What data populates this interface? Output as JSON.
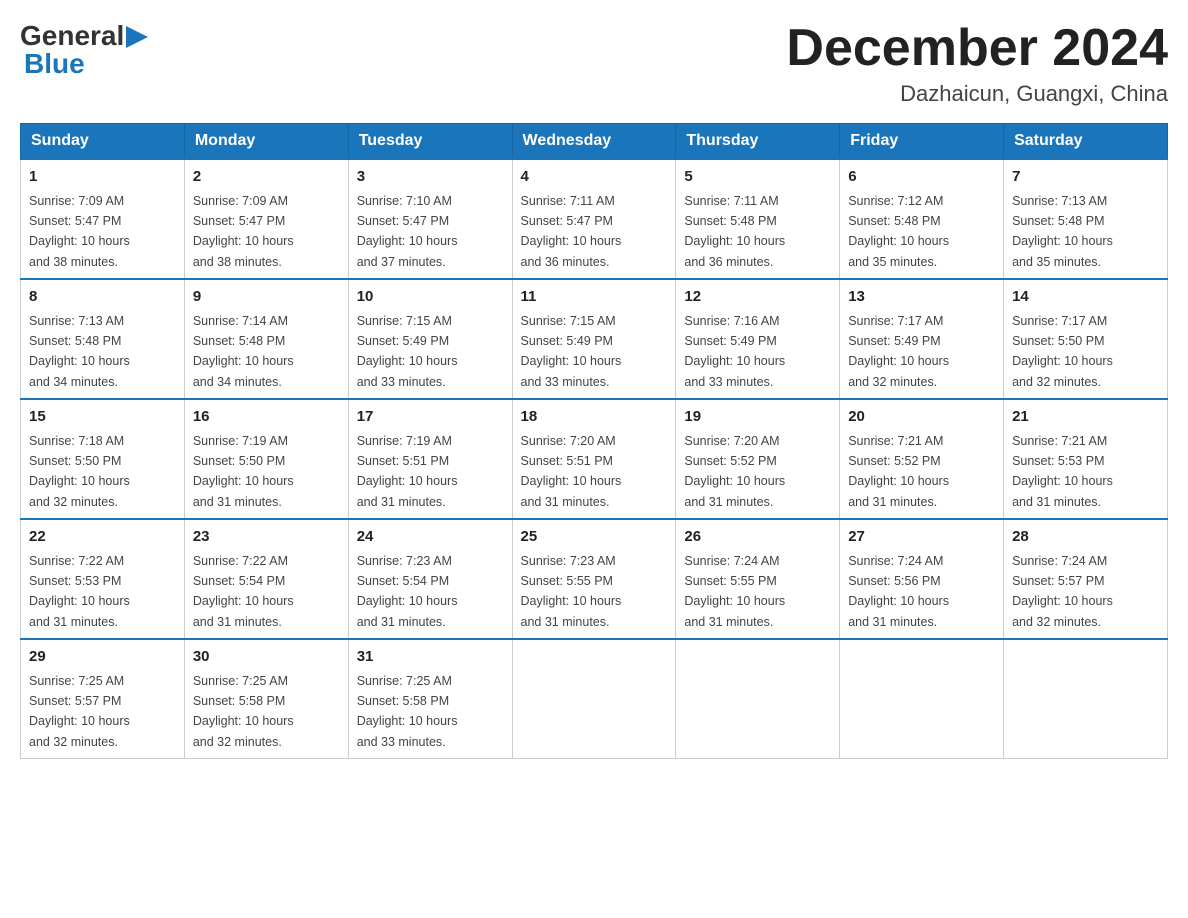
{
  "logo": {
    "text_general": "General",
    "text_blue": "Blue"
  },
  "title": "December 2024",
  "subtitle": "Dazhaicun, Guangxi, China",
  "days_of_week": [
    "Sunday",
    "Monday",
    "Tuesday",
    "Wednesday",
    "Thursday",
    "Friday",
    "Saturday"
  ],
  "weeks": [
    [
      {
        "day": "1",
        "sunrise": "7:09 AM",
        "sunset": "5:47 PM",
        "daylight": "10 hours and 38 minutes."
      },
      {
        "day": "2",
        "sunrise": "7:09 AM",
        "sunset": "5:47 PM",
        "daylight": "10 hours and 38 minutes."
      },
      {
        "day": "3",
        "sunrise": "7:10 AM",
        "sunset": "5:47 PM",
        "daylight": "10 hours and 37 minutes."
      },
      {
        "day": "4",
        "sunrise": "7:11 AM",
        "sunset": "5:47 PM",
        "daylight": "10 hours and 36 minutes."
      },
      {
        "day": "5",
        "sunrise": "7:11 AM",
        "sunset": "5:48 PM",
        "daylight": "10 hours and 36 minutes."
      },
      {
        "day": "6",
        "sunrise": "7:12 AM",
        "sunset": "5:48 PM",
        "daylight": "10 hours and 35 minutes."
      },
      {
        "day": "7",
        "sunrise": "7:13 AM",
        "sunset": "5:48 PM",
        "daylight": "10 hours and 35 minutes."
      }
    ],
    [
      {
        "day": "8",
        "sunrise": "7:13 AM",
        "sunset": "5:48 PM",
        "daylight": "10 hours and 34 minutes."
      },
      {
        "day": "9",
        "sunrise": "7:14 AM",
        "sunset": "5:48 PM",
        "daylight": "10 hours and 34 minutes."
      },
      {
        "day": "10",
        "sunrise": "7:15 AM",
        "sunset": "5:49 PM",
        "daylight": "10 hours and 33 minutes."
      },
      {
        "day": "11",
        "sunrise": "7:15 AM",
        "sunset": "5:49 PM",
        "daylight": "10 hours and 33 minutes."
      },
      {
        "day": "12",
        "sunrise": "7:16 AM",
        "sunset": "5:49 PM",
        "daylight": "10 hours and 33 minutes."
      },
      {
        "day": "13",
        "sunrise": "7:17 AM",
        "sunset": "5:49 PM",
        "daylight": "10 hours and 32 minutes."
      },
      {
        "day": "14",
        "sunrise": "7:17 AM",
        "sunset": "5:50 PM",
        "daylight": "10 hours and 32 minutes."
      }
    ],
    [
      {
        "day": "15",
        "sunrise": "7:18 AM",
        "sunset": "5:50 PM",
        "daylight": "10 hours and 32 minutes."
      },
      {
        "day": "16",
        "sunrise": "7:19 AM",
        "sunset": "5:50 PM",
        "daylight": "10 hours and 31 minutes."
      },
      {
        "day": "17",
        "sunrise": "7:19 AM",
        "sunset": "5:51 PM",
        "daylight": "10 hours and 31 minutes."
      },
      {
        "day": "18",
        "sunrise": "7:20 AM",
        "sunset": "5:51 PM",
        "daylight": "10 hours and 31 minutes."
      },
      {
        "day": "19",
        "sunrise": "7:20 AM",
        "sunset": "5:52 PM",
        "daylight": "10 hours and 31 minutes."
      },
      {
        "day": "20",
        "sunrise": "7:21 AM",
        "sunset": "5:52 PM",
        "daylight": "10 hours and 31 minutes."
      },
      {
        "day": "21",
        "sunrise": "7:21 AM",
        "sunset": "5:53 PM",
        "daylight": "10 hours and 31 minutes."
      }
    ],
    [
      {
        "day": "22",
        "sunrise": "7:22 AM",
        "sunset": "5:53 PM",
        "daylight": "10 hours and 31 minutes."
      },
      {
        "day": "23",
        "sunrise": "7:22 AM",
        "sunset": "5:54 PM",
        "daylight": "10 hours and 31 minutes."
      },
      {
        "day": "24",
        "sunrise": "7:23 AM",
        "sunset": "5:54 PM",
        "daylight": "10 hours and 31 minutes."
      },
      {
        "day": "25",
        "sunrise": "7:23 AM",
        "sunset": "5:55 PM",
        "daylight": "10 hours and 31 minutes."
      },
      {
        "day": "26",
        "sunrise": "7:24 AM",
        "sunset": "5:55 PM",
        "daylight": "10 hours and 31 minutes."
      },
      {
        "day": "27",
        "sunrise": "7:24 AM",
        "sunset": "5:56 PM",
        "daylight": "10 hours and 31 minutes."
      },
      {
        "day": "28",
        "sunrise": "7:24 AM",
        "sunset": "5:57 PM",
        "daylight": "10 hours and 32 minutes."
      }
    ],
    [
      {
        "day": "29",
        "sunrise": "7:25 AM",
        "sunset": "5:57 PM",
        "daylight": "10 hours and 32 minutes."
      },
      {
        "day": "30",
        "sunrise": "7:25 AM",
        "sunset": "5:58 PM",
        "daylight": "10 hours and 32 minutes."
      },
      {
        "day": "31",
        "sunrise": "7:25 AM",
        "sunset": "5:58 PM",
        "daylight": "10 hours and 33 minutes."
      },
      null,
      null,
      null,
      null
    ]
  ],
  "labels": {
    "sunrise": "Sunrise:",
    "sunset": "Sunset:",
    "daylight": "Daylight:"
  }
}
